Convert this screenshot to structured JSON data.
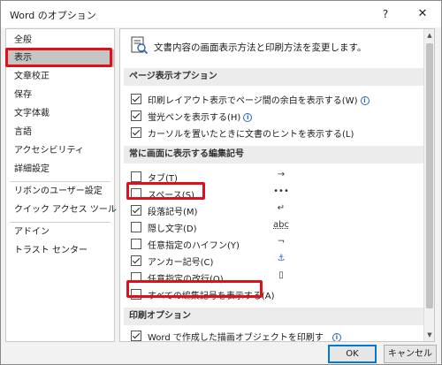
{
  "window": {
    "title": "Word のオプション",
    "help_label": "?",
    "close_label": "✕"
  },
  "sidebar": {
    "items": [
      {
        "label": "全般"
      },
      {
        "label": "表示"
      },
      {
        "label": "文章校正"
      },
      {
        "label": "保存"
      },
      {
        "label": "文字体裁"
      },
      {
        "label": "言語"
      },
      {
        "label": "アクセシビリティ"
      },
      {
        "label": "詳細設定"
      },
      {
        "label": "リボンのユーザー設定"
      },
      {
        "label": "クイック アクセス ツール バー"
      },
      {
        "label": "アドイン"
      },
      {
        "label": "トラスト センター"
      }
    ],
    "selected": "表示"
  },
  "content": {
    "header": "文書内容の画面表示方法と印刷方法を変更します。",
    "page_display": {
      "title": "ページ表示オプション",
      "options": [
        {
          "label": "印刷レイアウト表示でページ間の余白を表示する(W)",
          "checked": true,
          "info_icon": "info-icon"
        },
        {
          "label": "蛍光ペンを表示する(H)",
          "checked": true,
          "info_icon": "info-icon"
        },
        {
          "label": "カーソルを置いたときに文書のヒントを表示する(L)",
          "checked": true
        }
      ]
    },
    "formatting_marks": {
      "title": "常に画面に表示する編集記号",
      "options": [
        {
          "label": "タブ(T)",
          "checked": false,
          "mark": "→"
        },
        {
          "label": "スペース(S)",
          "checked": false,
          "mark": "•••"
        },
        {
          "label": "段落記号(M)",
          "checked": true,
          "mark": "↵"
        },
        {
          "label": "隠し文字(D)",
          "checked": false,
          "mark": "abc"
        },
        {
          "label": "任意指定のハイフン(Y)",
          "checked": false,
          "mark": "¬"
        },
        {
          "label": "アンカー記号(C)",
          "checked": true,
          "mark": "⚓"
        },
        {
          "label": "任意指定の改行(O)",
          "checked": false,
          "mark": "▯"
        },
        {
          "label": "すべての編集記号を表示する(A)",
          "checked": false
        }
      ]
    },
    "print": {
      "title": "印刷オプション",
      "options": [
        {
          "label": "Word で作成した描画オブジェクトを印刷す",
          "checked": true,
          "info_icon": "info-icon"
        }
      ]
    }
  },
  "buttons": {
    "ok": "OK",
    "cancel": "キャンセル"
  },
  "colors": {
    "highlight_red": "#e0101a",
    "selected_bg": "#c5c5c5",
    "info_blue": "#2a62c9"
  }
}
